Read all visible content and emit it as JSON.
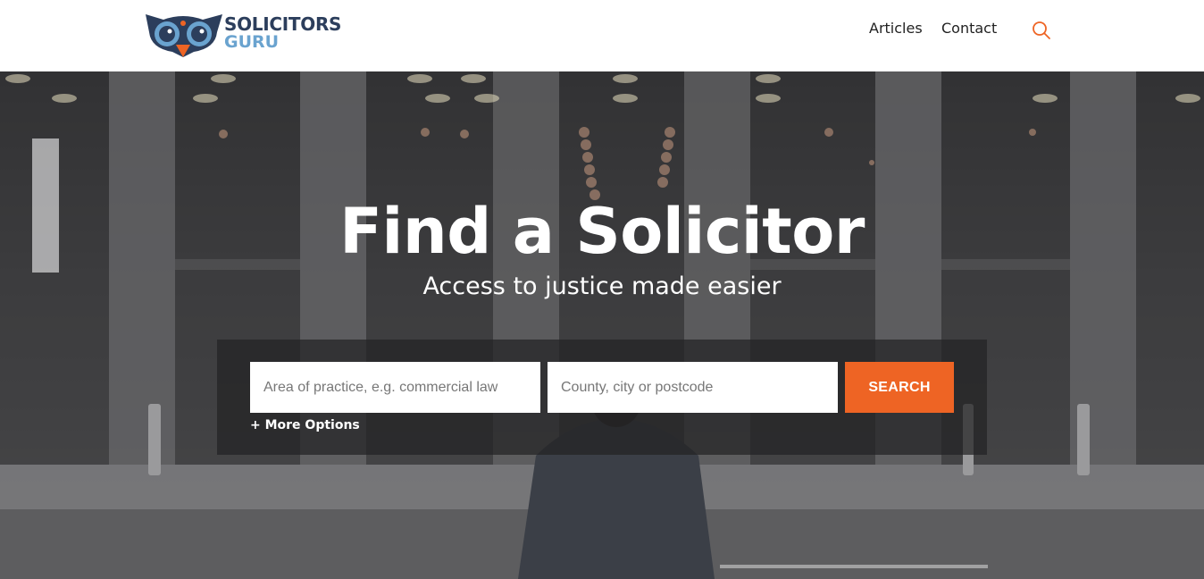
{
  "brand": {
    "line1": "SOLICITORS",
    "line2": "GURU",
    "colors": {
      "navy": "#2c3e5c",
      "light_blue": "#6aa3cf",
      "orange": "#ee6424"
    }
  },
  "nav": {
    "items": [
      {
        "label": "Articles"
      },
      {
        "label": "Contact"
      }
    ],
    "search_icon": "search-icon"
  },
  "hero": {
    "title": "Find a Solicitor",
    "subtitle": "Access to justice made easier"
  },
  "search": {
    "practice_placeholder": "Area of practice, e.g. commercial law",
    "practice_value": "",
    "location_placeholder": "County, city or postcode",
    "location_value": "",
    "button_label": "SEARCH",
    "more_options": "+ More Options",
    "button_color": "#ee6424"
  }
}
